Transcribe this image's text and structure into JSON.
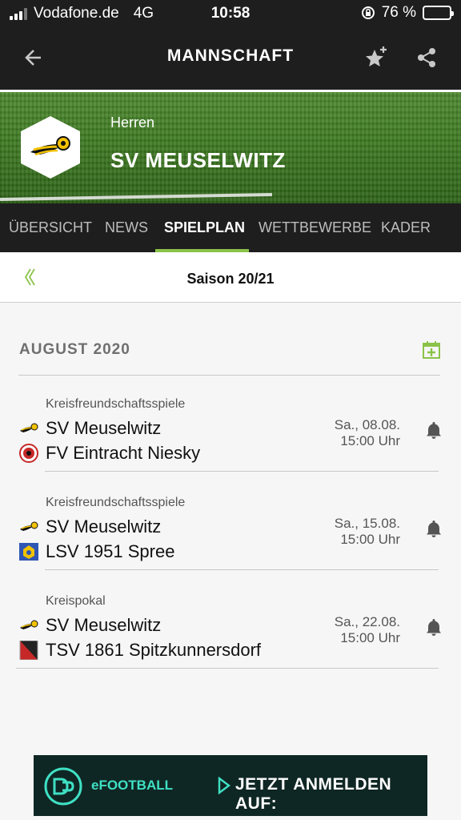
{
  "status": {
    "carrier": "Vodafone.de",
    "network": "4G",
    "time": "10:58",
    "battery": "76 %",
    "battery_level": 0.76
  },
  "app_bar": {
    "title": "MANNSCHAFT"
  },
  "team": {
    "category": "Herren",
    "name": "SV MEUSELWITZ"
  },
  "tabs": [
    {
      "label": "ÜBERSICHT"
    },
    {
      "label": "NEWS"
    },
    {
      "label": "SPIELPLAN",
      "active": true
    },
    {
      "label": "WETTBEWERBE"
    },
    {
      "label": "KADER"
    }
  ],
  "season": {
    "label": "Saison 20/21"
  },
  "month": {
    "label": "AUGUST 2020"
  },
  "matches": [
    {
      "competition": "Kreisfreundschaftsspiele",
      "home": "SV Meuselwitz",
      "away": "FV Eintracht Niesky",
      "date": "Sa., 08.08.",
      "time": "15:00 Uhr"
    },
    {
      "competition": "Kreisfreundschaftsspiele",
      "home": "SV Meuselwitz",
      "away": "LSV 1951 Spree",
      "date": "Sa., 15.08.",
      "time": "15:00 Uhr"
    },
    {
      "competition": "Kreispokal",
      "home": "SV Meuselwitz",
      "away": "TSV 1861 Spitzkunnersdorf",
      "date": "Sa., 22.08.",
      "time": "15:00 Uhr"
    }
  ],
  "ad": {
    "brand": "eFOOTBALL",
    "cta": "JETZT ANMELDEN AUF:"
  },
  "colors": {
    "accent": "#8bc34a",
    "dark": "#1e1e1e",
    "ad_bg": "#0f2724",
    "ad_teal": "#3fe0c4"
  }
}
